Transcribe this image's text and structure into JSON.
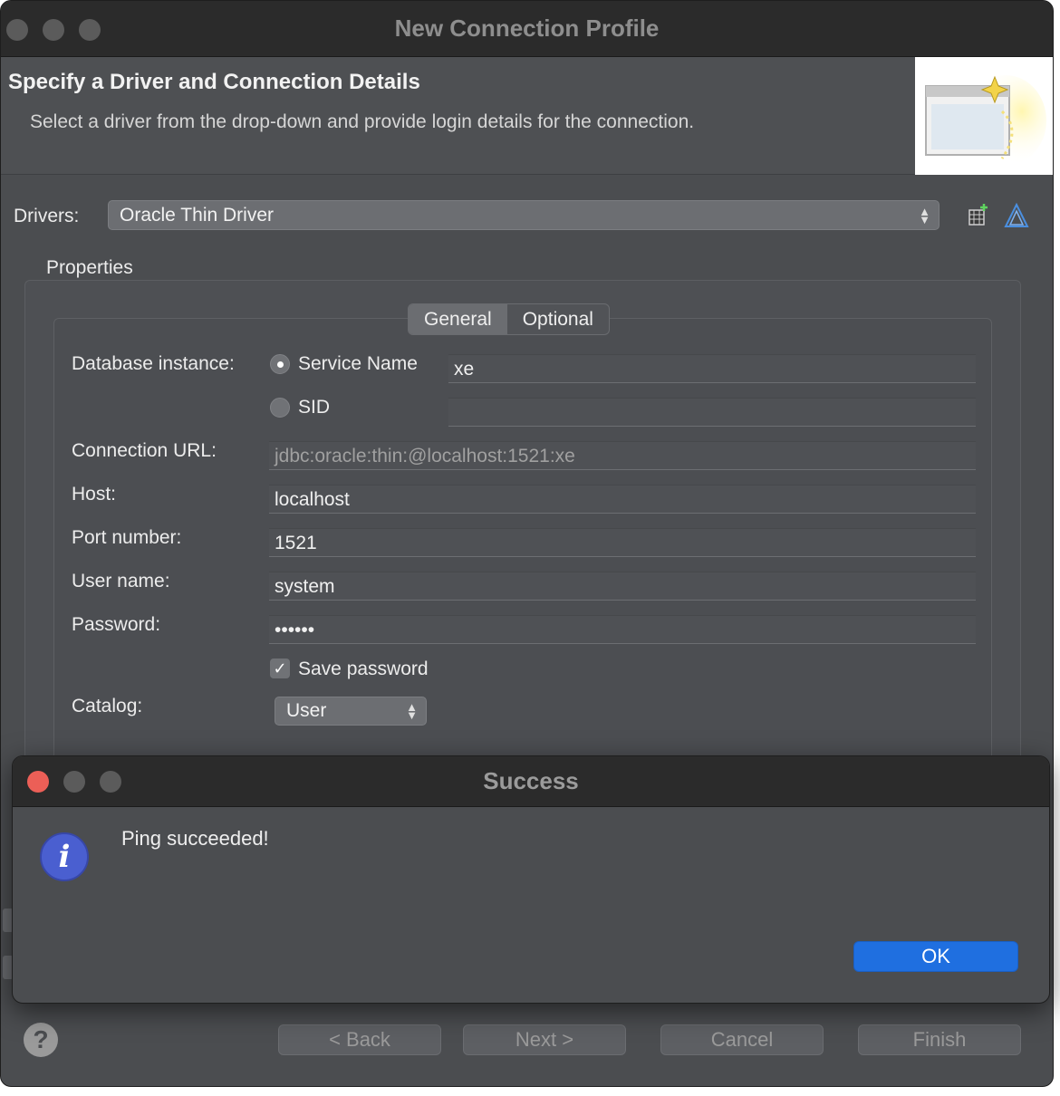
{
  "window": {
    "title": "New Connection Profile"
  },
  "banner": {
    "title": "Specify a Driver and Connection Details",
    "description": "Select a driver from the drop-down and provide login details for the connection.",
    "image_icon": "wizard-banner-icon"
  },
  "drivers": {
    "label": "Drivers:",
    "selected": "Oracle Thin Driver",
    "tool_icons": [
      "new-driver-icon",
      "edit-driver-icon"
    ]
  },
  "properties": {
    "label": "Properties",
    "tabs": [
      {
        "label": "General",
        "active": true
      },
      {
        "label": "Optional",
        "active": false
      }
    ],
    "database_instance": {
      "label": "Database instance:",
      "options": [
        {
          "label": "Service Name",
          "selected": true,
          "value": "xe"
        },
        {
          "label": "SID",
          "selected": false,
          "value": ""
        }
      ]
    },
    "connection_url": {
      "label": "Connection URL:",
      "value": "jdbc:oracle:thin:@localhost:1521:xe"
    },
    "host": {
      "label": "Host:",
      "value": "localhost"
    },
    "port": {
      "label": "Port number:",
      "value": "1521"
    },
    "user": {
      "label": "User name:",
      "value": "system"
    },
    "password": {
      "label": "Password:",
      "value": "••••••"
    },
    "save_password": {
      "label": "Save password",
      "checked": true
    },
    "catalog": {
      "label": "Catalog:",
      "selected": "User"
    }
  },
  "footer": {
    "back": "< Back",
    "next": "Next >",
    "cancel": "Cancel",
    "finish": "Finish",
    "help": "?"
  },
  "dialog": {
    "title": "Success",
    "message": "Ping succeeded!",
    "ok": "OK",
    "icon": "i"
  },
  "colors": {
    "window_bg": "#4b4d50",
    "titlebar": "#2b2b2b",
    "close_red": "#ec5f57",
    "ok_blue": "#1f6fe0",
    "info_blue": "#4a5fd0"
  }
}
